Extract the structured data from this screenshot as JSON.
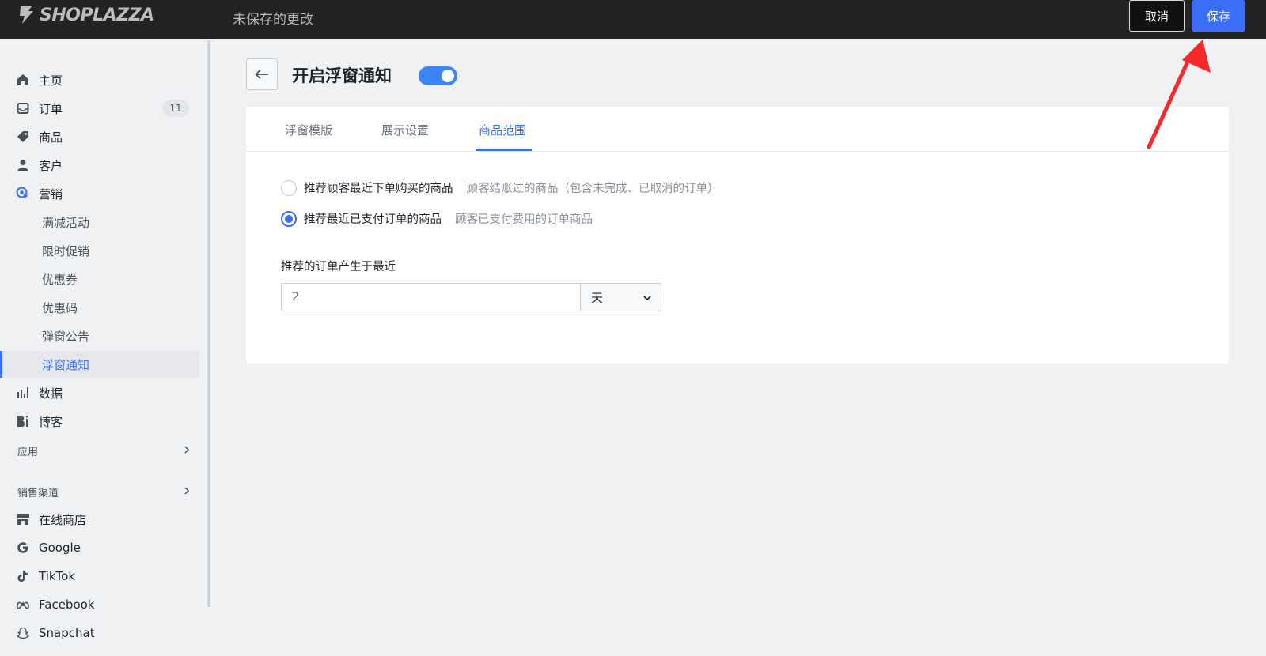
{
  "header": {
    "logo_text": "SHOPLAZZA",
    "unsaved_text": "未保存的更改",
    "cancel_label": "取消",
    "save_label": "保存"
  },
  "sidebar": {
    "items": [
      {
        "label": "主页",
        "icon": "home-icon"
      },
      {
        "label": "订单",
        "icon": "inbox-icon",
        "badge": "11"
      },
      {
        "label": "商品",
        "icon": "tag-icon"
      },
      {
        "label": "客户",
        "icon": "person-icon"
      },
      {
        "label": "营销",
        "icon": "marketing-icon"
      },
      {
        "label": "满减活动"
      },
      {
        "label": "限时促销"
      },
      {
        "label": "优惠券"
      },
      {
        "label": "优惠码"
      },
      {
        "label": "弹窗公告"
      },
      {
        "label": "浮窗通知"
      },
      {
        "label": "数据",
        "icon": "bar-chart-icon"
      },
      {
        "label": "博客",
        "icon": "blog-icon"
      }
    ],
    "apps_label": "应用",
    "channels_label": "销售渠道",
    "channels": [
      {
        "label": "在线商店",
        "icon": "store-icon"
      },
      {
        "label": "Google",
        "icon": "google-icon"
      },
      {
        "label": "TikTok",
        "icon": "tiktok-icon"
      },
      {
        "label": "Facebook",
        "icon": "meta-icon"
      },
      {
        "label": "Snapchat",
        "icon": "snapchat-icon"
      }
    ]
  },
  "main": {
    "title": "开启浮窗通知",
    "toggle_on": true,
    "tabs": [
      "浮窗模版",
      "展示设置",
      "商品范围"
    ],
    "active_tab": 2,
    "options": [
      {
        "label": "推荐顾客最近下单购买的商品",
        "hint": "顾客结账过的商品（包含未完成、已取消的订单）",
        "checked": false
      },
      {
        "label": "推荐最近已支付订单的商品",
        "hint": "顾客已支付费用的订单商品",
        "checked": true
      }
    ],
    "field_label": "推荐的订单产生于最近",
    "field_value": "2",
    "unit_value": "天"
  },
  "colors": {
    "accent": "#3b6ef6",
    "topbar": "#232323",
    "annotation_arrow": "#f5282a"
  }
}
